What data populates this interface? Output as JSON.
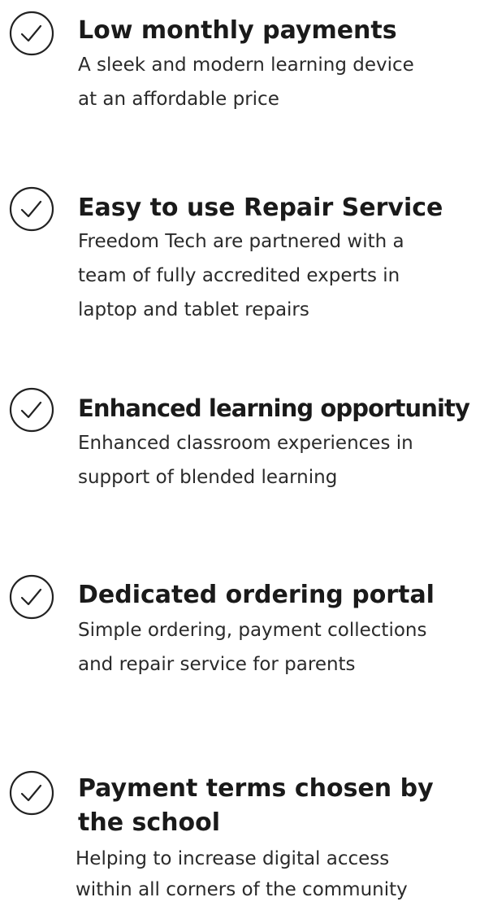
{
  "features": [
    {
      "icon": "check-circle-icon",
      "title": "Low monthly payments",
      "description_lines": [
        "A sleek and modern learning device",
        "at an affordable price"
      ]
    },
    {
      "icon": "check-circle-icon",
      "title": "Easy to use Repair Service",
      "description_lines": [
        "Freedom Tech are partnered with a",
        "team of fully accredited experts in",
        "laptop and tablet repairs"
      ]
    },
    {
      "icon": "check-circle-icon",
      "title": "Enhanced learning opportunity",
      "description_lines": [
        "Enhanced classroom experiences in",
        "support of blended learning"
      ]
    },
    {
      "icon": "check-circle-icon",
      "title": "Dedicated ordering portal",
      "description_lines": [
        "Simple ordering, payment collections",
        "and repair service for parents"
      ]
    },
    {
      "icon": "check-circle-icon",
      "title_lines": [
        "Payment terms chosen by",
        "the school"
      ],
      "description_lines": [
        "Helping to increase digital access",
        "within all corners of the community"
      ]
    }
  ],
  "colors": {
    "text": "#1a1a1a",
    "icon_stroke": "#222222",
    "background": "#ffffff"
  }
}
